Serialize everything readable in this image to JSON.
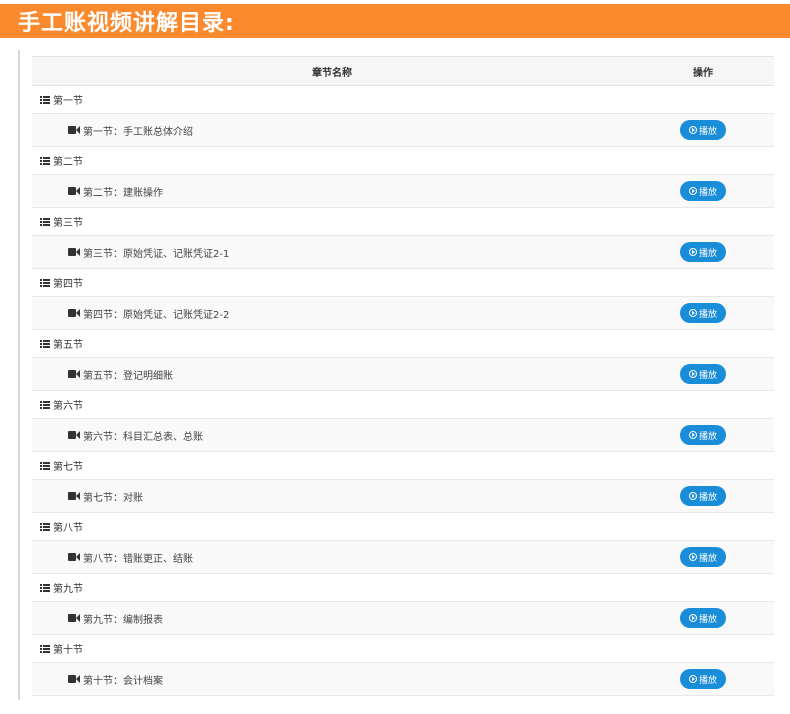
{
  "header": {
    "title": "手工账视频讲解目录:"
  },
  "table": {
    "col_name": "章节名称",
    "col_action": "操作",
    "play_label": "播放",
    "sections": [
      {
        "label": "第一节",
        "lesson": "第一节：手工账总体介绍"
      },
      {
        "label": "第二节",
        "lesson": "第二节：建账操作"
      },
      {
        "label": "第三节",
        "lesson": "第三节：原始凭证、记账凭证2-1"
      },
      {
        "label": "第四节",
        "lesson": "第四节：原始凭证、记账凭证2-2"
      },
      {
        "label": "第五节",
        "lesson": "第五节：登记明细账"
      },
      {
        "label": "第六节",
        "lesson": "第六节：科目汇总表、总账"
      },
      {
        "label": "第七节",
        "lesson": "第七节：对账"
      },
      {
        "label": "第八节",
        "lesson": "第八节：错账更正、结账"
      },
      {
        "label": "第九节",
        "lesson": "第九节：编制报表"
      },
      {
        "label": "第十节",
        "lesson": "第十节：会计档案"
      }
    ]
  },
  "colors": {
    "banner": "#fb8a2e",
    "button": "#1a8dd8"
  }
}
